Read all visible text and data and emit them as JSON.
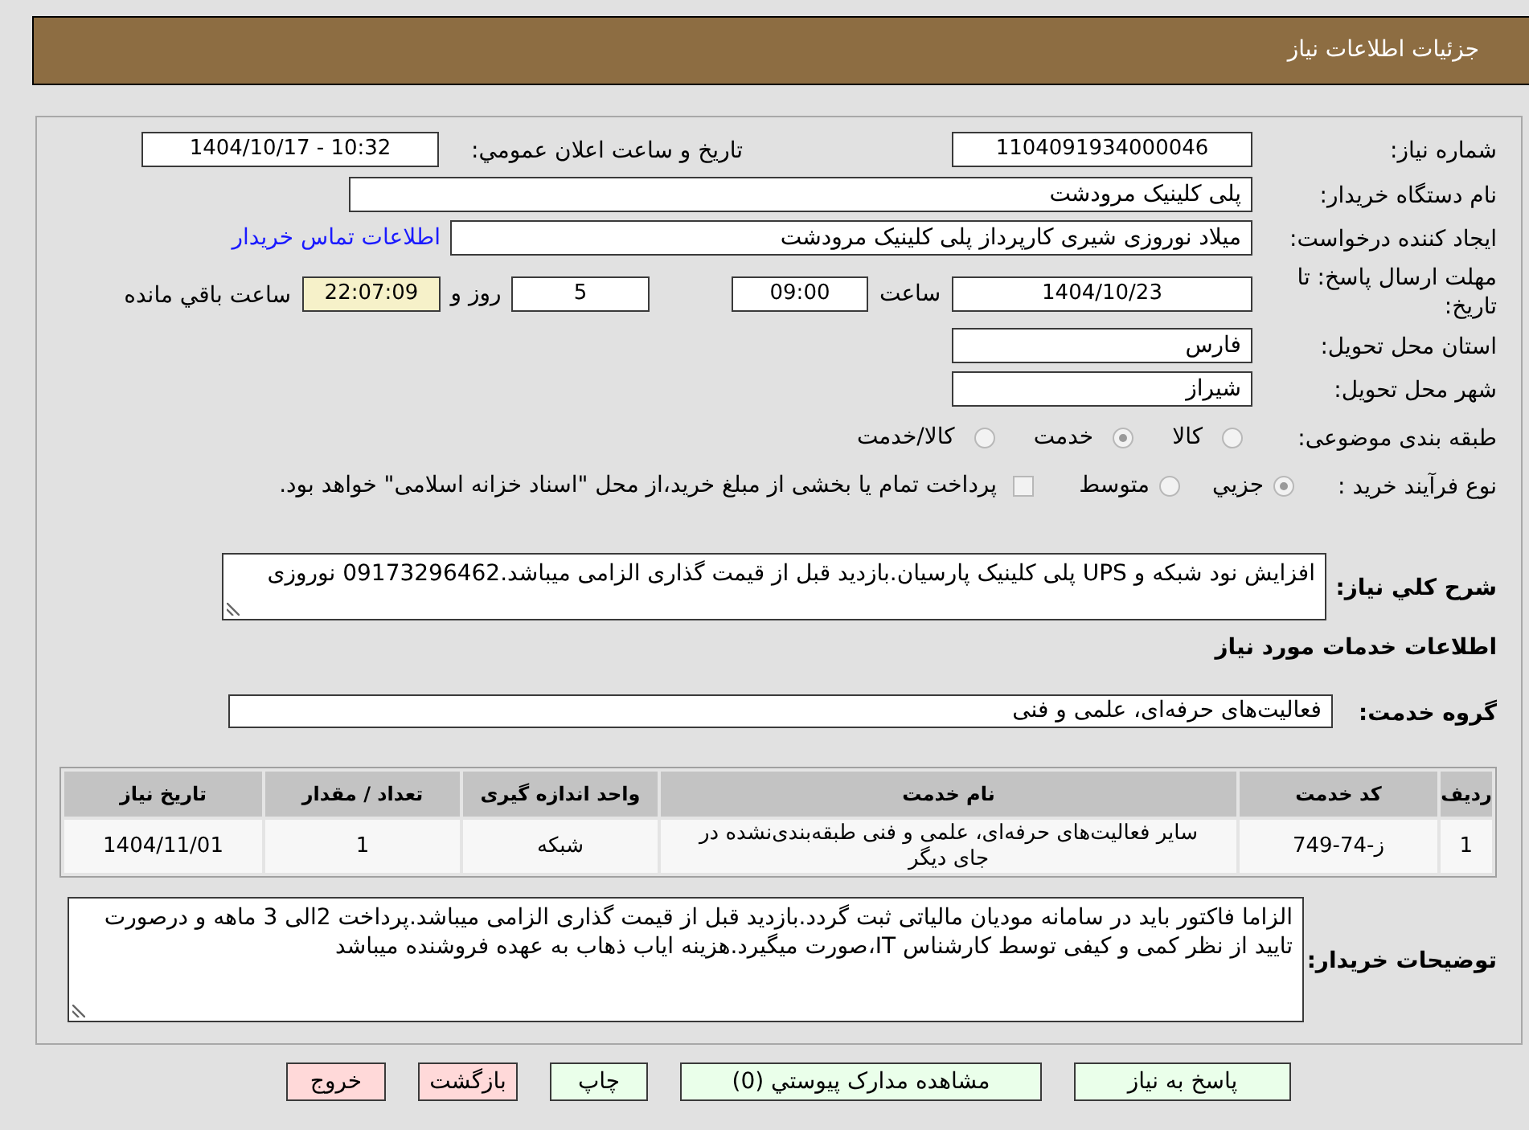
{
  "header": {
    "title": "جزئیات اطلاعات نیاز"
  },
  "need_number": {
    "label": "شماره نیاز:",
    "value": "1104091934000046"
  },
  "announcement": {
    "label": "تاریخ و ساعت اعلان عمومي:",
    "value": "1404/10/17 - 10:32"
  },
  "buyer_org": {
    "label": "نام دستگاه خریدار:",
    "value": "پلی کلینیک مرودشت"
  },
  "requester": {
    "label": "ایجاد کننده درخواست:",
    "value": "میلاد نوروزی شیری کارپرداز پلی کلینیک مرودشت",
    "contact_link": "اطلاعات تماس خریدار"
  },
  "deadline": {
    "label": "مهلت ارسال پاسخ: تا تاریخ:",
    "date": "1404/10/23",
    "time_label": "ساعت",
    "time": "09:00",
    "days": "5",
    "days_label": "روز و",
    "remaining": "22:07:09",
    "remaining_label": "ساعت باقي مانده"
  },
  "province": {
    "label": "استان محل تحویل:",
    "value": "فارس"
  },
  "city": {
    "label": "شهر محل تحویل:",
    "value": "شیراز"
  },
  "classification": {
    "label": "طبقه بندی موضوعی:",
    "disabled": true,
    "options": [
      {
        "label": "کالا",
        "selected": false
      },
      {
        "label": "خدمت",
        "selected": true
      },
      {
        "label": "کالا/خدمت",
        "selected": false
      }
    ]
  },
  "purchase_process": {
    "label": "نوع فرآیند خرید :",
    "disabled": true,
    "options": [
      {
        "label": "جزيي",
        "selected": true
      },
      {
        "label": "متوسط",
        "selected": false
      }
    ],
    "treasury_payment": {
      "label": "پرداخت تمام یا بخشی از مبلغ خرید،از محل \"اسناد خزانه اسلامی\" خواهد بود.",
      "checked": false,
      "disabled": true
    }
  },
  "description": {
    "label": "شرح کلي نیاز:",
    "value": "افزایش نود شبکه و UPS پلی کلینیک پارسیان.بازدید قبل از قیمت گذاری الزامی میباشد.09173296462 نوروزی"
  },
  "services_title": "اطلاعات خدمات مورد نیاز",
  "service_group": {
    "label": "گروه خدمت:",
    "value": "فعالیت‌های حرفه‌ای، علمی و فنی"
  },
  "services_table": {
    "columns": [
      "ردیف",
      "کد خدمت",
      "نام خدمت",
      "واحد اندازه گیری",
      "تعداد / مقدار",
      "تاریخ نیاز"
    ],
    "rows": [
      [
        "1",
        "ز-74-749",
        "سایر فعالیت‌های حرفه‌ای، علمی و فنی طبقه‌بندی‌نشده در جای دیگر",
        "شبکه",
        "1",
        "1404/11/01"
      ]
    ]
  },
  "buyer_notes": {
    "label": "توضیحات خریدار:",
    "value": "الزاما فاکتور باید در سامانه مودیان مالیاتی ثبت گردد.بازدید قبل از قیمت گذاری الزامی میباشد.پرداخت 2الی 3 ماهه و درصورت تایید از نظر کمی و کیفی توسط کارشناس IT،صورت میگیرد.هزینه ایاب ذهاب به عهده فروشنده میباشد"
  },
  "buttons": [
    {
      "label": "پاسخ به نیاز",
      "kind": "action"
    },
    {
      "label": "مشاهده مدارک پیوستي (0)",
      "kind": "action"
    },
    {
      "label": "چاپ",
      "kind": "action"
    },
    {
      "label": "بازگشت",
      "kind": "exit"
    },
    {
      "label": "خروج",
      "kind": "exit"
    }
  ]
}
